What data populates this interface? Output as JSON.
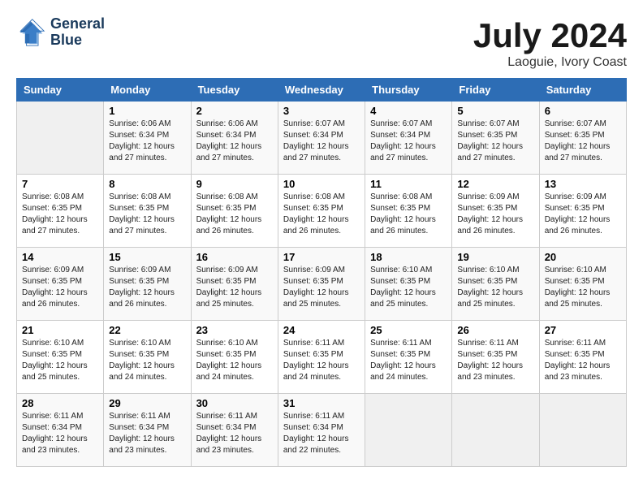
{
  "logo": {
    "line1": "General",
    "line2": "Blue"
  },
  "title": "July 2024",
  "subtitle": "Laoguie, Ivory Coast",
  "days_of_week": [
    "Sunday",
    "Monday",
    "Tuesday",
    "Wednesday",
    "Thursday",
    "Friday",
    "Saturday"
  ],
  "weeks": [
    [
      {
        "day": "",
        "sunrise": "",
        "sunset": "",
        "daylight": ""
      },
      {
        "day": "1",
        "sunrise": "Sunrise: 6:06 AM",
        "sunset": "Sunset: 6:34 PM",
        "daylight": "Daylight: 12 hours and 27 minutes."
      },
      {
        "day": "2",
        "sunrise": "Sunrise: 6:06 AM",
        "sunset": "Sunset: 6:34 PM",
        "daylight": "Daylight: 12 hours and 27 minutes."
      },
      {
        "day": "3",
        "sunrise": "Sunrise: 6:07 AM",
        "sunset": "Sunset: 6:34 PM",
        "daylight": "Daylight: 12 hours and 27 minutes."
      },
      {
        "day": "4",
        "sunrise": "Sunrise: 6:07 AM",
        "sunset": "Sunset: 6:34 PM",
        "daylight": "Daylight: 12 hours and 27 minutes."
      },
      {
        "day": "5",
        "sunrise": "Sunrise: 6:07 AM",
        "sunset": "Sunset: 6:35 PM",
        "daylight": "Daylight: 12 hours and 27 minutes."
      },
      {
        "day": "6",
        "sunrise": "Sunrise: 6:07 AM",
        "sunset": "Sunset: 6:35 PM",
        "daylight": "Daylight: 12 hours and 27 minutes."
      }
    ],
    [
      {
        "day": "7",
        "sunrise": "Sunrise: 6:08 AM",
        "sunset": "Sunset: 6:35 PM",
        "daylight": "Daylight: 12 hours and 27 minutes."
      },
      {
        "day": "8",
        "sunrise": "Sunrise: 6:08 AM",
        "sunset": "Sunset: 6:35 PM",
        "daylight": "Daylight: 12 hours and 27 minutes."
      },
      {
        "day": "9",
        "sunrise": "Sunrise: 6:08 AM",
        "sunset": "Sunset: 6:35 PM",
        "daylight": "Daylight: 12 hours and 26 minutes."
      },
      {
        "day": "10",
        "sunrise": "Sunrise: 6:08 AM",
        "sunset": "Sunset: 6:35 PM",
        "daylight": "Daylight: 12 hours and 26 minutes."
      },
      {
        "day": "11",
        "sunrise": "Sunrise: 6:08 AM",
        "sunset": "Sunset: 6:35 PM",
        "daylight": "Daylight: 12 hours and 26 minutes."
      },
      {
        "day": "12",
        "sunrise": "Sunrise: 6:09 AM",
        "sunset": "Sunset: 6:35 PM",
        "daylight": "Daylight: 12 hours and 26 minutes."
      },
      {
        "day": "13",
        "sunrise": "Sunrise: 6:09 AM",
        "sunset": "Sunset: 6:35 PM",
        "daylight": "Daylight: 12 hours and 26 minutes."
      }
    ],
    [
      {
        "day": "14",
        "sunrise": "Sunrise: 6:09 AM",
        "sunset": "Sunset: 6:35 PM",
        "daylight": "Daylight: 12 hours and 26 minutes."
      },
      {
        "day": "15",
        "sunrise": "Sunrise: 6:09 AM",
        "sunset": "Sunset: 6:35 PM",
        "daylight": "Daylight: 12 hours and 26 minutes."
      },
      {
        "day": "16",
        "sunrise": "Sunrise: 6:09 AM",
        "sunset": "Sunset: 6:35 PM",
        "daylight": "Daylight: 12 hours and 25 minutes."
      },
      {
        "day": "17",
        "sunrise": "Sunrise: 6:09 AM",
        "sunset": "Sunset: 6:35 PM",
        "daylight": "Daylight: 12 hours and 25 minutes."
      },
      {
        "day": "18",
        "sunrise": "Sunrise: 6:10 AM",
        "sunset": "Sunset: 6:35 PM",
        "daylight": "Daylight: 12 hours and 25 minutes."
      },
      {
        "day": "19",
        "sunrise": "Sunrise: 6:10 AM",
        "sunset": "Sunset: 6:35 PM",
        "daylight": "Daylight: 12 hours and 25 minutes."
      },
      {
        "day": "20",
        "sunrise": "Sunrise: 6:10 AM",
        "sunset": "Sunset: 6:35 PM",
        "daylight": "Daylight: 12 hours and 25 minutes."
      }
    ],
    [
      {
        "day": "21",
        "sunrise": "Sunrise: 6:10 AM",
        "sunset": "Sunset: 6:35 PM",
        "daylight": "Daylight: 12 hours and 25 minutes."
      },
      {
        "day": "22",
        "sunrise": "Sunrise: 6:10 AM",
        "sunset": "Sunset: 6:35 PM",
        "daylight": "Daylight: 12 hours and 24 minutes."
      },
      {
        "day": "23",
        "sunrise": "Sunrise: 6:10 AM",
        "sunset": "Sunset: 6:35 PM",
        "daylight": "Daylight: 12 hours and 24 minutes."
      },
      {
        "day": "24",
        "sunrise": "Sunrise: 6:11 AM",
        "sunset": "Sunset: 6:35 PM",
        "daylight": "Daylight: 12 hours and 24 minutes."
      },
      {
        "day": "25",
        "sunrise": "Sunrise: 6:11 AM",
        "sunset": "Sunset: 6:35 PM",
        "daylight": "Daylight: 12 hours and 24 minutes."
      },
      {
        "day": "26",
        "sunrise": "Sunrise: 6:11 AM",
        "sunset": "Sunset: 6:35 PM",
        "daylight": "Daylight: 12 hours and 23 minutes."
      },
      {
        "day": "27",
        "sunrise": "Sunrise: 6:11 AM",
        "sunset": "Sunset: 6:35 PM",
        "daylight": "Daylight: 12 hours and 23 minutes."
      }
    ],
    [
      {
        "day": "28",
        "sunrise": "Sunrise: 6:11 AM",
        "sunset": "Sunset: 6:34 PM",
        "daylight": "Daylight: 12 hours and 23 minutes."
      },
      {
        "day": "29",
        "sunrise": "Sunrise: 6:11 AM",
        "sunset": "Sunset: 6:34 PM",
        "daylight": "Daylight: 12 hours and 23 minutes."
      },
      {
        "day": "30",
        "sunrise": "Sunrise: 6:11 AM",
        "sunset": "Sunset: 6:34 PM",
        "daylight": "Daylight: 12 hours and 23 minutes."
      },
      {
        "day": "31",
        "sunrise": "Sunrise: 6:11 AM",
        "sunset": "Sunset: 6:34 PM",
        "daylight": "Daylight: 12 hours and 22 minutes."
      },
      {
        "day": "",
        "sunrise": "",
        "sunset": "",
        "daylight": ""
      },
      {
        "day": "",
        "sunrise": "",
        "sunset": "",
        "daylight": ""
      },
      {
        "day": "",
        "sunrise": "",
        "sunset": "",
        "daylight": ""
      }
    ]
  ]
}
